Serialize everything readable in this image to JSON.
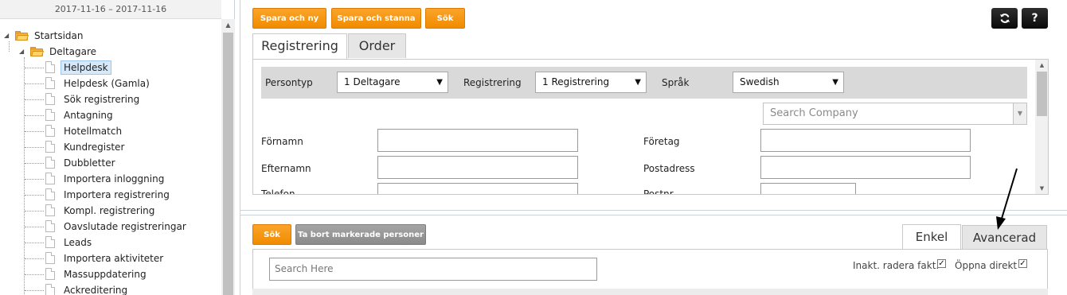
{
  "sidebar": {
    "date_range": "2017-11-16  –  2017-11-16",
    "root": {
      "label": "Startsidan",
      "icon": "folder-open-icon"
    },
    "group": {
      "label": "Deltagare",
      "icon": "folder-open-icon"
    },
    "items": [
      {
        "label": "Helpdesk",
        "selected": true
      },
      {
        "label": "Helpdesk (Gamla)"
      },
      {
        "label": "Sök registrering"
      },
      {
        "label": "Antagning"
      },
      {
        "label": "Hotellmatch"
      },
      {
        "label": "Kundregister"
      },
      {
        "label": "Dubbletter"
      },
      {
        "label": "Importera inloggning"
      },
      {
        "label": "Importera registrering"
      },
      {
        "label": "Kompl. registrering"
      },
      {
        "label": "Oavslutade registreringar"
      },
      {
        "label": "Leads"
      },
      {
        "label": "Importera aktiviteter"
      },
      {
        "label": "Massuppdatering"
      },
      {
        "label": "Ackreditering"
      }
    ]
  },
  "toolbar": {
    "save_new_label": "Spara och ny",
    "save_stay_label": "Spara och stanna",
    "search_label": "Sök",
    "refresh_icon": "refresh-icon",
    "help_label": "?"
  },
  "tabs": [
    {
      "label": "Registrering",
      "active": true
    },
    {
      "label": "Order",
      "active": false
    }
  ],
  "filters": {
    "persontyp_label": "Persontyp",
    "persontyp_value": "1 Deltagare",
    "registrering_label": "Registrering",
    "registrering_value": "1 Registrering",
    "sprak_label": "Språk",
    "sprak_value": "Swedish",
    "company_search_placeholder": "Search Company"
  },
  "form": {
    "fornamn": "Förnamn",
    "efternamn": "Efternamn",
    "telefon": "Telefon",
    "foretag": "Företag",
    "postadress": "Postadress",
    "postnr": "Postnr"
  },
  "bottom": {
    "search_label": "Sök",
    "remove_label": "Ta bort markerade personer",
    "tab_simple": "Enkel",
    "tab_advanced": "Avancerad",
    "search_placeholder": "Search Here",
    "inakt_label": "Inakt. radera fakt.",
    "inakt_checked": true,
    "oppna_label": "Öppna direkt",
    "oppna_checked": true
  },
  "colors": {
    "orange": "#f39200",
    "gray_button": "#959595",
    "dark_button": "#111111",
    "selected_bg": "#d6e9fb"
  }
}
